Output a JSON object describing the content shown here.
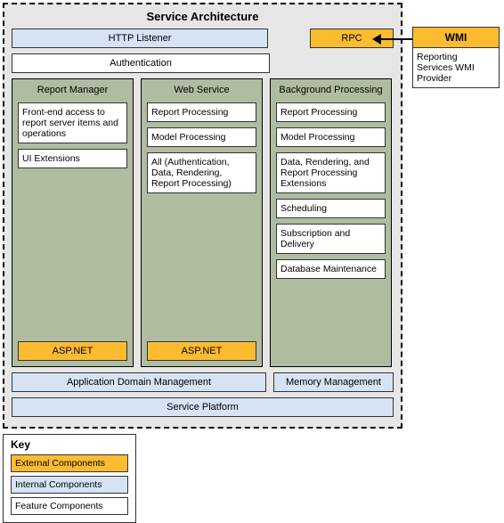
{
  "title": "Service Architecture",
  "top": {
    "http_listener": "HTTP Listener",
    "rpc": "RPC",
    "auth": "Authentication"
  },
  "columns": {
    "report_manager": {
      "title": "Report Manager",
      "items": [
        "Front-end access to report server items and operations",
        "UI Extensions"
      ],
      "footer": "ASP.NET"
    },
    "web_service": {
      "title": "Web Service",
      "items": [
        "Report Processing",
        "Model Processing",
        "All (Authentication, Data, Rendering, Report Processing)"
      ],
      "footer": "ASP.NET"
    },
    "background": {
      "title": "Background Processing",
      "items": [
        "Report Processing",
        "Model Processing",
        "Data, Rendering, and Report Processing Extensions",
        "Scheduling",
        "Subscription and Delivery",
        "Database Maintenance"
      ]
    }
  },
  "bottom": {
    "app_domain": "Application Domain Management",
    "memory": "Memory Management",
    "platform": "Service Platform"
  },
  "wmi": {
    "header": "WMI",
    "body": "Reporting Services WMI Provider"
  },
  "key": {
    "title": "Key",
    "external": "External Components",
    "internal": "Internal Components",
    "feature": "Feature Components"
  }
}
